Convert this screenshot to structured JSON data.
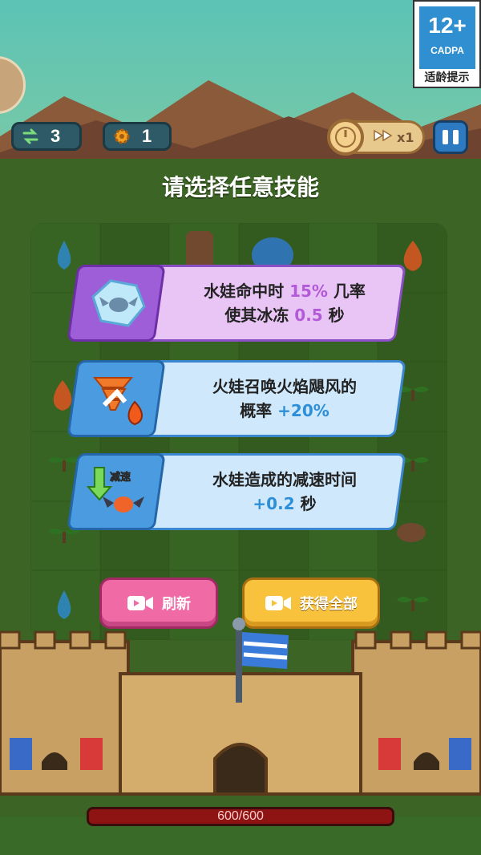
{
  "age_rating": {
    "number": "12+",
    "org": "CADPA",
    "tip": "适龄提示"
  },
  "hud": {
    "swaps": "3",
    "gears": "1",
    "speed": "x1"
  },
  "title": "请选择任意技能",
  "skills": [
    {
      "line1_pre": "水娃命中时 ",
      "line1_hl": "15%",
      "line1_post": " 几率",
      "line2_pre": "使其冰冻 ",
      "line2_hl": "0.5",
      "line2_post": " 秒"
    },
    {
      "line1_pre": "火娃召唤火焰飓风的",
      "line1_hl": "",
      "line1_post": "",
      "line2_pre": "概率 ",
      "line2_hl": "+20%",
      "line2_post": ""
    },
    {
      "line1_pre": "水娃造成的减速时间",
      "line1_hl": "",
      "line1_post": "",
      "line2_pre": "",
      "line2_hl": "+0.2",
      "line2_post": " 秒",
      "icon_label": "减速"
    }
  ],
  "buttons": {
    "refresh": "刷新",
    "get_all": "获得全部"
  },
  "health": {
    "text": "600/600",
    "current": 600,
    "max": 600
  },
  "colors": {
    "purple_card": "#e9c5f5",
    "blue_card": "#cfe8fb",
    "refresh_btn": "#f06aa6",
    "getall_btn": "#f8c23c",
    "hp_bar": "#8e1414"
  },
  "icons": [
    "swap-icon",
    "gear-icon",
    "clock-icon",
    "fast-forward-icon",
    "pause-icon",
    "video-icon",
    "ice-bat-icon",
    "fire-tornado-icon",
    "slow-bat-icon"
  ]
}
